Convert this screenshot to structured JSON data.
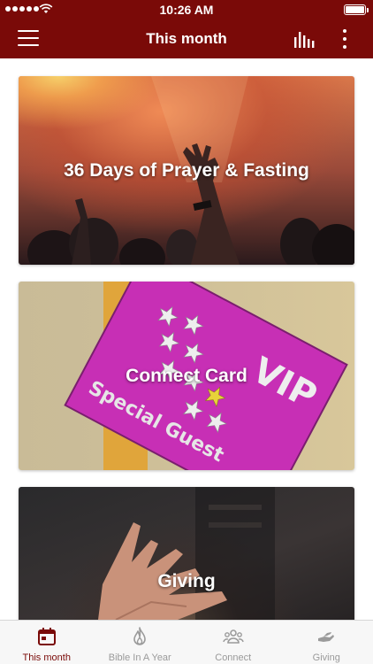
{
  "status_bar": {
    "time": "10:26 AM"
  },
  "nav": {
    "title": "This month",
    "menu_icon": "hamburger-menu-icon",
    "chart_icon": "bar-chart-icon",
    "more_icon": "more-vertical-icon"
  },
  "cards": [
    {
      "title": "36 Days of Prayer & Fasting"
    },
    {
      "title": "Connect Card",
      "image_text": {
        "vip": "VIP",
        "special": "Special Guest"
      }
    },
    {
      "title": "Giving"
    }
  ],
  "tabs": [
    {
      "label": "This month",
      "icon": "calendar-icon",
      "active": true
    },
    {
      "label": "Bible In A Year",
      "icon": "flame-icon",
      "active": false
    },
    {
      "label": "Connect",
      "icon": "people-icon",
      "active": false
    },
    {
      "label": "Giving",
      "icon": "giving-hand-icon",
      "active": false
    }
  ],
  "colors": {
    "brand": "#7a0a08",
    "tab_inactive": "#9a9a9a",
    "vip_card": "#c72fb5"
  }
}
